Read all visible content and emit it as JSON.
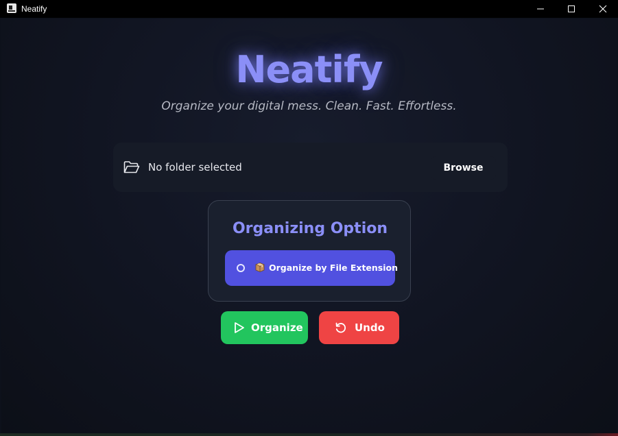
{
  "window": {
    "title": "Neatify"
  },
  "header": {
    "app_title": "Neatify",
    "tagline": "Organize your digital mess. Clean. Fast. Effortless."
  },
  "folder": {
    "status": "No folder selected",
    "browse_label": "Browse",
    "icon": "folder-open-icon"
  },
  "options": {
    "title": "Organizing Option",
    "items": [
      {
        "label": "Organize by File Extension",
        "icon": "package-icon",
        "selected": false
      }
    ]
  },
  "actions": {
    "organize_label": "Organize",
    "organize_icon": "play-icon",
    "undo_label": "Undo",
    "undo_icon": "undo-icon"
  },
  "colors": {
    "accent": "#8b8ff7",
    "option_bg": "#5151e0",
    "organize_bg": "#22c55e",
    "undo_bg": "#ef4444",
    "background": "#121624"
  }
}
